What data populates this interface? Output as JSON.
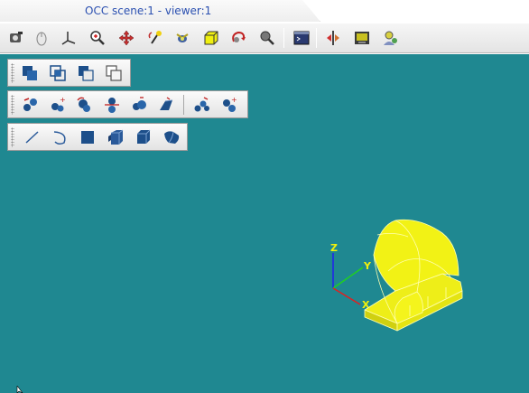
{
  "window": {
    "title": "OCC scene:1 - viewer:1"
  },
  "main_toolbar": {
    "icons": [
      "fit-all-icon",
      "select-mouse-icon",
      "axis-icon",
      "zoom-icon",
      "pan-icon",
      "rotate-icon",
      "fly-icon",
      "shading-icon",
      "reset-view-icon",
      "clipping-icon",
      "terminal-icon",
      "split-icon",
      "snapshot-icon",
      "users-icon"
    ]
  },
  "boolean_toolbar": {
    "icons": [
      "union-icon",
      "intersect-icon",
      "subtract-icon",
      "cut-icon"
    ]
  },
  "transform_toolbar": {
    "icons": [
      "translate-icon",
      "point-icon",
      "rotate-object-icon",
      "mirror-icon",
      "scale-icon",
      "sweep-icon",
      "multi-translate-icon",
      "multi-rotate-icon"
    ]
  },
  "primitive_toolbar": {
    "icons": [
      "line-icon",
      "arc-icon",
      "face-icon",
      "extrude-icon",
      "box-icon",
      "revolve-icon"
    ]
  },
  "trihedron": {
    "labels": {
      "x": "X",
      "y": "Y",
      "z": "Z"
    },
    "colors": {
      "x": "#e02020",
      "y": "#20d020",
      "z": "#2020f0"
    }
  },
  "colors": {
    "background": "#1f8891",
    "shape_fill": "#f2f215",
    "shape_dark": "#c9c90a",
    "title_text": "#2a4fb0"
  }
}
